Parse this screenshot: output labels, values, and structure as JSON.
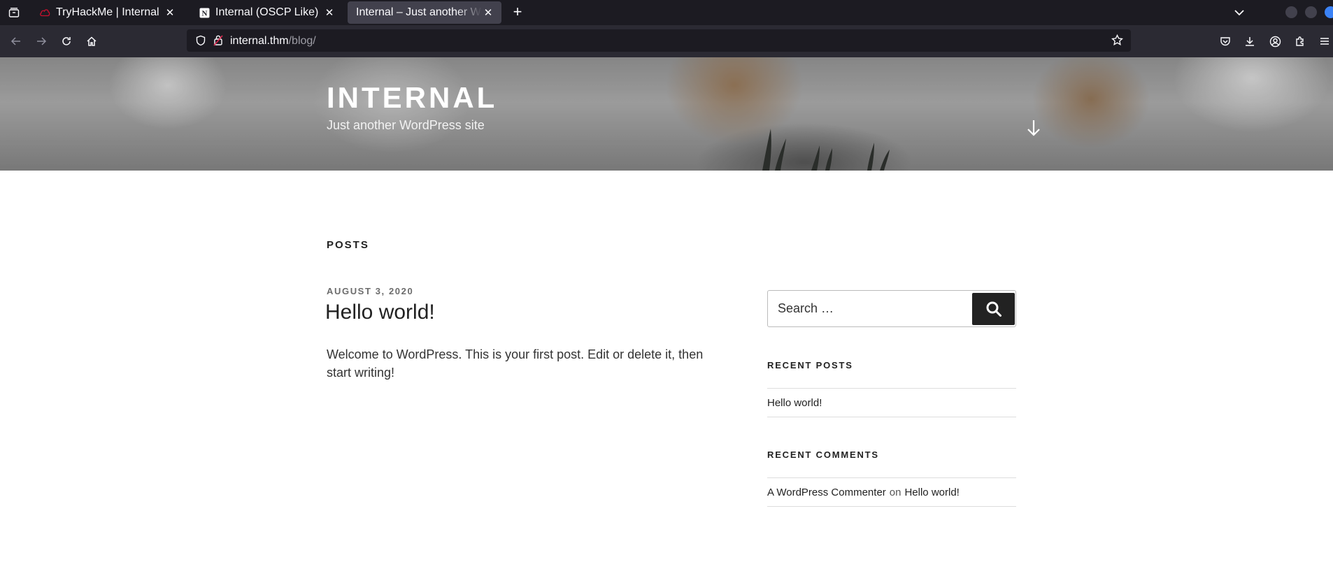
{
  "browser": {
    "tabs": [
      {
        "title": "TryHackMe | Internal",
        "favicon": "tryhackme-cloud-icon"
      },
      {
        "title": "Internal (OSCP Like)",
        "favicon": "notion-icon"
      },
      {
        "title": "Internal – Just another WordPress site",
        "favicon": "none",
        "active": true
      }
    ],
    "url_domain": "internal.thm",
    "url_path": "/blog/"
  },
  "site": {
    "title": "INTERNAL",
    "description": "Just another WordPress site"
  },
  "main": {
    "heading": "POSTS",
    "post": {
      "date": "AUGUST 3, 2020",
      "title": "Hello world!",
      "body": "Welcome to WordPress. This is your first post. Edit or delete it, then start writing!"
    }
  },
  "sidebar": {
    "search_placeholder": "Search …",
    "recent_posts": {
      "title": "RECENT POSTS",
      "items": [
        "Hello world!"
      ]
    },
    "recent_comments": {
      "title": "RECENT COMMENTS",
      "items": [
        {
          "author": "A WordPress Commenter",
          "connector": "on",
          "post": "Hello world!"
        }
      ]
    }
  },
  "colors": {
    "tabbar_bg": "#1c1b22",
    "toolbar_bg": "#2b2a33",
    "text_dark": "#222222",
    "search_button": "#222222"
  }
}
